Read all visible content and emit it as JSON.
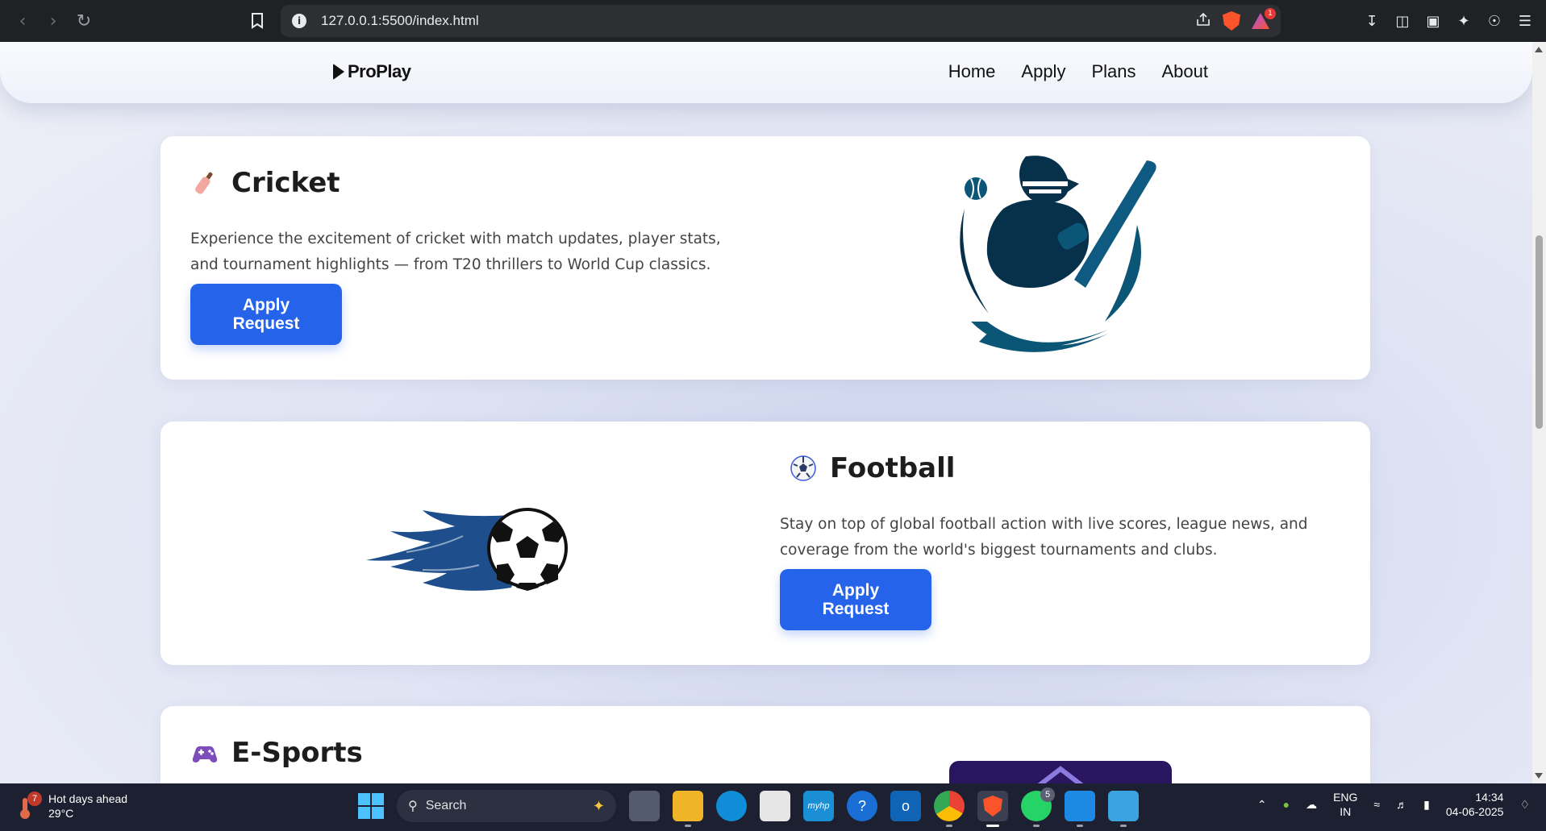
{
  "browser": {
    "url": "127.0.0.1:5500/index.html",
    "rewards_badge": "1"
  },
  "site": {
    "logo": "ProPlay",
    "nav": [
      "Home",
      "Apply",
      "Plans",
      "About"
    ]
  },
  "cards": [
    {
      "title": "Cricket",
      "description": "Experience the excitement of cricket with match updates, player stats, and tournament highlights — from T20 thrillers to World Cup classics.",
      "button": "Apply Request",
      "icon": "cricket-bat-icon"
    },
    {
      "title": "Football",
      "description": "Stay on top of global football action with live scores, league news, and coverage from the world's biggest tournaments and clubs.",
      "button": "Apply Request",
      "icon": "soccer-ball-icon"
    },
    {
      "title": "E-Sports",
      "icon": "gamepad-icon"
    }
  ],
  "taskbar": {
    "weather_title": "Hot days ahead",
    "weather_temp": "29°C",
    "weather_badge": "7",
    "search_placeholder": "Search",
    "whatsapp_badge": "5",
    "lang_top": "ENG",
    "lang_bottom": "IN",
    "time": "14:34",
    "date": "04-06-2025"
  },
  "colors": {
    "accent": "#2563eb",
    "cricket_art": "#0b5576",
    "football_art": "#1e4f8c"
  }
}
